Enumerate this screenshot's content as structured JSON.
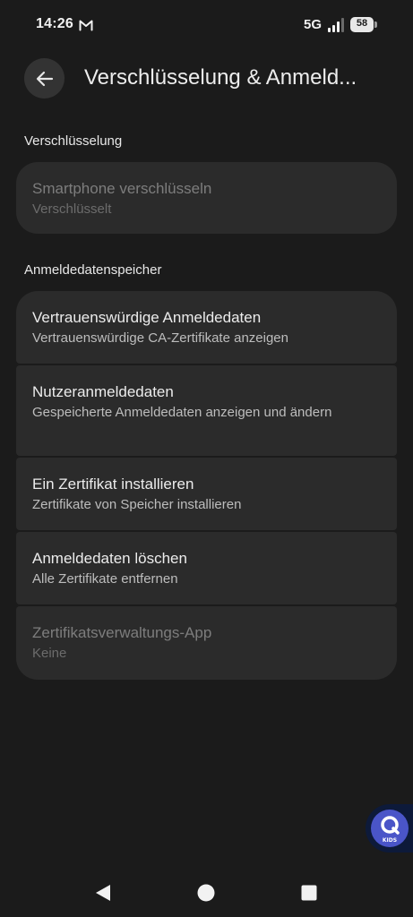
{
  "status_bar": {
    "time": "14:26",
    "notification_icon": "gmail-icon",
    "network": "5G",
    "battery_level": "58"
  },
  "app_bar": {
    "back_icon": "arrow-back-icon",
    "title": "Verschlüsselung & Anmeld..."
  },
  "sections": [
    {
      "header": "Verschlüsselung",
      "items": [
        {
          "title": "Smartphone verschlüsseln",
          "subtitle": "Verschlüsselt",
          "enabled": false
        }
      ]
    },
    {
      "header": "Anmeldedatenspeicher",
      "items": [
        {
          "title": "Vertrauenswürdige Anmeldedaten",
          "subtitle": "Vertrauenswürdige CA-Zertifikate anzeigen",
          "enabled": true
        },
        {
          "title": "Nutzeranmeldedaten",
          "subtitle": "Gespeicherte Anmeldedaten anzeigen und ändern",
          "enabled": true
        },
        {
          "title": "Ein Zertifikat installieren",
          "subtitle": "Zertifikate von Speicher installieren",
          "enabled": true
        },
        {
          "title": "Anmeldedaten löschen",
          "subtitle": "Alle Zertifikate entfernen",
          "enabled": true
        },
        {
          "title": "Zertifikatsverwaltungs-App",
          "subtitle": "Keine",
          "enabled": false
        }
      ]
    }
  ],
  "floating_bubble": {
    "label": "KIDS",
    "icon": "q-kids-icon"
  },
  "nav_bar": {
    "back": "nav-back-icon",
    "home": "nav-home-icon",
    "recents": "nav-recents-icon"
  }
}
